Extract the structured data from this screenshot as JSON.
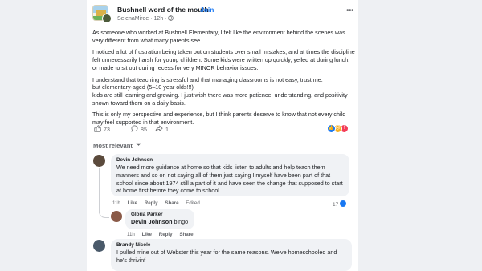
{
  "post": {
    "group_name": "Bushnell word of the mouth",
    "join_label": "· Join",
    "author": "SelenaMiree",
    "time": "· 12h ·",
    "paragraphs": [
      "As someone who worked at Bushnell Elementary, I felt like the environment behind the scenes was very different from what many parents see.",
      "I noticed a lot of frustration being taken out on students over small mistakes, and at times the discipline felt unnecessarily harsh for young children. Some kids were written up quickly, yelled at during lunch, or made to sit out during recess for very MINOR behavior issues.",
      "I understand that teaching is stressful and that managing classrooms is not easy, trust me.",
      "but elementary-aged (5–10 year olds!!!)",
      "kids are still learning and growing. I just wish there was more patience, understanding, and positivity shown toward them on a daily basis.",
      "This is only my perspective and experience, but I think parents deserve to know that not every child may feel supported in that environment."
    ],
    "stats": {
      "likes": "73",
      "comments": "85",
      "shares": "1"
    }
  },
  "comments_header": "Most relevant",
  "comments": [
    {
      "name": "Devin Johnson",
      "text": "We need more guidance at home so that kids listen to adults and help teach them manners and so on not saying all of them just saying I myself have been part of that school since about 1974 still a part of it and have seen the change that supposed to start at home first before they come to school",
      "actions": {
        "time": "11h",
        "like": "Like",
        "reply": "Reply",
        "share": "Share",
        "edited": "Edited"
      },
      "reactions": "17"
    },
    {
      "name": "Gloria Parker",
      "mention": "Devin Johnson",
      "text": "bingo",
      "actions": {
        "time": "11h",
        "like": "Like",
        "reply": "Reply",
        "share": "Share"
      }
    },
    {
      "name": "Brandy Nicole",
      "text": "I pulled mine out of Webster this year for the same reasons. We've homeschooled and he's thrivinf",
      "actions": {}
    }
  ],
  "colors": {
    "link": "#1877f2",
    "muted": "#65676b",
    "bubble": "#f0f2f5"
  }
}
